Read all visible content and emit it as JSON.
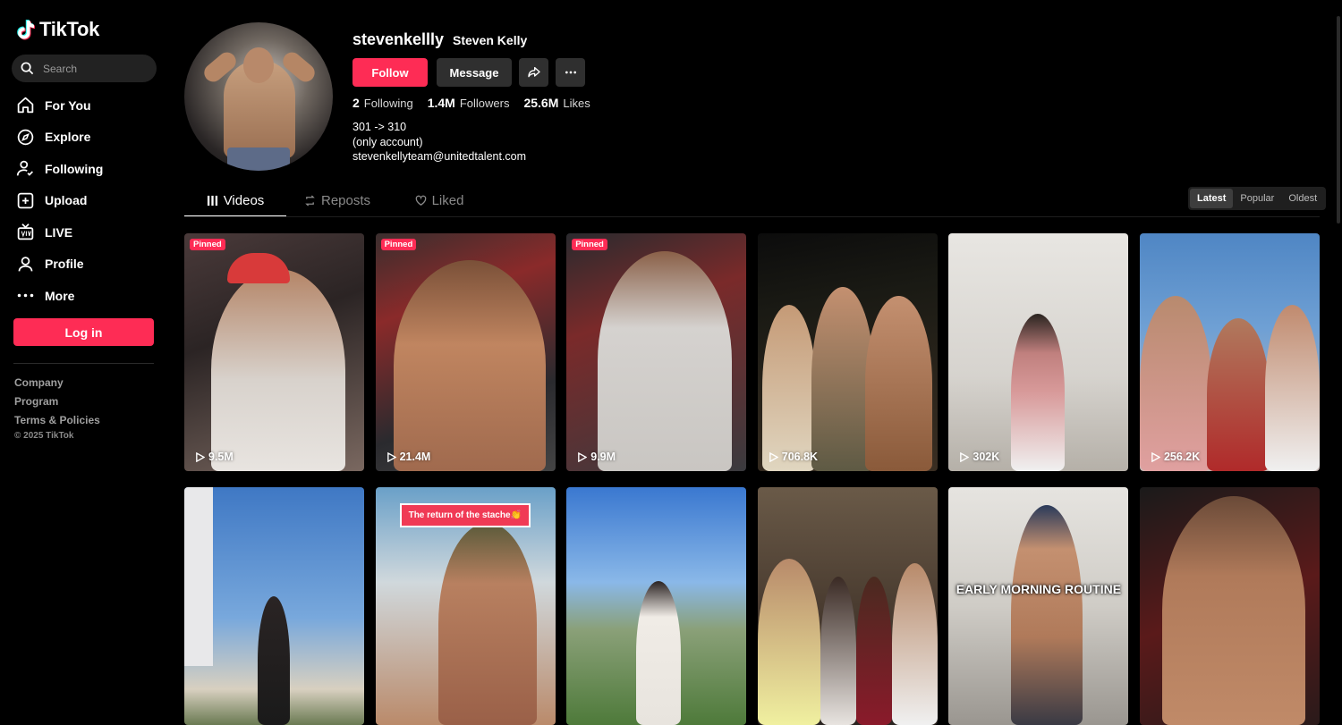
{
  "app": {
    "logo_text": "TikTok"
  },
  "search": {
    "placeholder": "Search"
  },
  "nav": [
    {
      "label": "For You",
      "icon": "home-icon"
    },
    {
      "label": "Explore",
      "icon": "compass-icon"
    },
    {
      "label": "Following",
      "icon": "following-icon"
    },
    {
      "label": "Upload",
      "icon": "upload-icon"
    },
    {
      "label": "LIVE",
      "icon": "live-icon"
    },
    {
      "label": "Profile",
      "icon": "profile-icon"
    },
    {
      "label": "More",
      "icon": "more-icon"
    }
  ],
  "login_label": "Log in",
  "footer": {
    "links": [
      "Company",
      "Program",
      "Terms & Policies"
    ],
    "copyright": "© 2025 TikTok"
  },
  "profile": {
    "username": "stevenkellly",
    "nickname": "Steven Kelly",
    "follow_label": "Follow",
    "message_label": "Message",
    "stats": {
      "following": "2",
      "following_label": "Following",
      "followers": "1.4M",
      "followers_label": "Followers",
      "likes": "25.6M",
      "likes_label": "Likes"
    },
    "bio": [
      "301 -> 310",
      "(only account)",
      "stevenkellyteam@unitedtalent.com"
    ]
  },
  "tabs": {
    "videos": "Videos",
    "reposts": "Reposts",
    "liked": "Liked"
  },
  "sort": {
    "latest": "Latest",
    "popular": "Popular",
    "oldest": "Oldest"
  },
  "pinned_label": "Pinned",
  "videos": [
    {
      "views": "9.5M",
      "pinned": true
    },
    {
      "views": "21.4M",
      "pinned": true
    },
    {
      "views": "9.9M",
      "pinned": true
    },
    {
      "views": "706.8K",
      "pinned": false
    },
    {
      "views": "302K",
      "pinned": false
    },
    {
      "views": "256.2K",
      "pinned": false
    },
    {
      "views": "",
      "pinned": false
    },
    {
      "views": "",
      "pinned": false,
      "overlay_banner": "The return of the stache👏"
    },
    {
      "views": "",
      "pinned": false
    },
    {
      "views": "",
      "pinned": false
    },
    {
      "views": "",
      "pinned": false,
      "overlay_caption": "EARLY MORNING ROUTINE"
    },
    {
      "views": "",
      "pinned": false
    }
  ],
  "colors": {
    "brand": "#fe2c55",
    "background": "#000000"
  }
}
